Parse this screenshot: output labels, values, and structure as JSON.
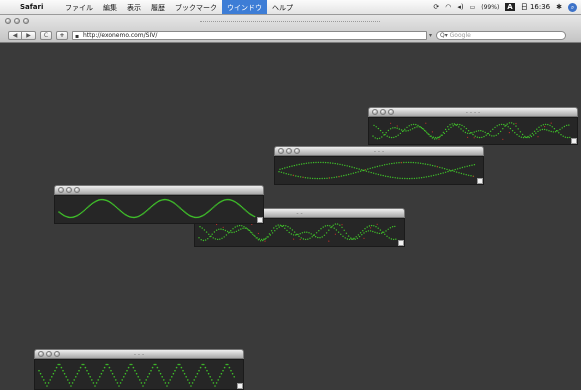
{
  "menubar": {
    "apple_icon": "apple-logo-icon",
    "app_name": "Safari",
    "menus": [
      "ファイル",
      "編集",
      "表示",
      "履歴",
      "ブックマーク",
      "ウインドウ",
      "ヘルプ"
    ],
    "active_menu_index": 5,
    "status": {
      "battery_label": "(99%)",
      "input_method": "A",
      "clock": "日 16:36"
    }
  },
  "browser": {
    "url": "http://exonemo.com/SIV/",
    "search_placeholder": "Google",
    "buttons": {
      "back": "◀",
      "forward": "▶",
      "reload": "C",
      "add_bookmark": "+"
    }
  },
  "windows": [
    {
      "id": "w1",
      "title": "- - - -",
      "wave": "scatter"
    },
    {
      "id": "w2",
      "title": "- - -",
      "wave": "twist"
    },
    {
      "id": "w3",
      "title": "",
      "wave": "sine"
    },
    {
      "id": "w4",
      "title": "- -",
      "wave": "scatter2"
    },
    {
      "id": "w5",
      "title": "- - -",
      "wave": "zigzag"
    }
  ],
  "colors": {
    "desktop": "#3a3a3a",
    "wave_green": "#3fbf2a",
    "wave_red": "#c0302a",
    "menu_highlight": "#3d7dd6"
  }
}
